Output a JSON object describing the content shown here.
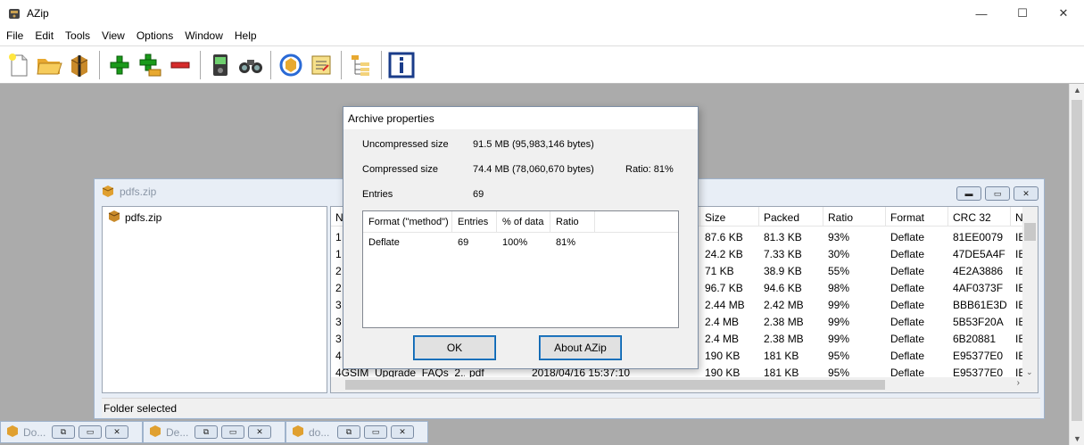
{
  "app": {
    "title": "AZip"
  },
  "window_controls": {
    "minimize": "—",
    "maximize": "☐",
    "close": "✕"
  },
  "menu": [
    "File",
    "Edit",
    "Tools",
    "View",
    "Options",
    "Window",
    "Help"
  ],
  "toolbar": {
    "icons": [
      "new-archive-icon",
      "open-archive-icon",
      "extract-icon",
      "add-icon",
      "add-folder-icon",
      "delete-icon",
      "test-icon",
      "find-icon",
      "recompress-icon",
      "update-icon",
      "tree-view-icon",
      "properties-icon"
    ]
  },
  "child_window": {
    "title": "pdfs.zip",
    "tree": {
      "item": "pdfs.zip"
    },
    "list": {
      "columns": [
        "N",
        "Size",
        "Packed",
        "Ratio",
        "Format",
        "CRC 32",
        "N"
      ],
      "rows": [
        {
          "n": "1",
          "size": "87.6 KB",
          "packed": "81.3 KB",
          "ratio": "93%",
          "format": "Deflate",
          "crc": "81EE0079",
          "x": "IE"
        },
        {
          "n": "1",
          "size": "24.2 KB",
          "packed": "7.33 KB",
          "ratio": "30%",
          "format": "Deflate",
          "crc": "47DE5A4F",
          "x": "IE"
        },
        {
          "n": "2",
          "size": "71 KB",
          "packed": "38.9 KB",
          "ratio": "55%",
          "format": "Deflate",
          "crc": "4E2A3886",
          "x": "IE"
        },
        {
          "n": "2",
          "size": "96.7 KB",
          "packed": "94.6 KB",
          "ratio": "98%",
          "format": "Deflate",
          "crc": "4AF0373F",
          "x": "IE"
        },
        {
          "n": "3",
          "size": "2.44 MB",
          "packed": "2.42 MB",
          "ratio": "99%",
          "format": "Deflate",
          "crc": "BBB61E3D",
          "x": "IE"
        },
        {
          "n": "3",
          "size": "2.4 MB",
          "packed": "2.38 MB",
          "ratio": "99%",
          "format": "Deflate",
          "crc": "5B53F20A",
          "x": "IE"
        },
        {
          "n": "3",
          "size": "2.4 MB",
          "packed": "2.38 MB",
          "ratio": "99%",
          "format": "Deflate",
          "crc": "6B20881",
          "x": "IE"
        },
        {
          "n": "4",
          "size": "190 KB",
          "packed": "181 KB",
          "ratio": "95%",
          "format": "Deflate",
          "crc": "E95377E0",
          "x": "IE"
        },
        {
          "n": "4GSIM_Upgrade_FAQs_2...",
          "type": "pdf",
          "date": "2018/04/16 15:37:10",
          "size": "190 KB",
          "packed": "181 KB",
          "ratio": "95%",
          "format": "Deflate",
          "crc": "E95377E0",
          "x": "IE"
        }
      ]
    },
    "status": "Folder selected"
  },
  "minimized_windows": [
    {
      "title": "Do..."
    },
    {
      "title": "De..."
    },
    {
      "title": "do..."
    }
  ],
  "dialog": {
    "title": "Archive properties",
    "uncompressed_label": "Uncompressed size",
    "uncompressed_value": "91.5 MB (95,983,146 bytes)",
    "compressed_label": "Compressed size",
    "compressed_value": "74.4 MB (78,060,670 bytes)",
    "ratio_text": "Ratio: 81%",
    "entries_label": "Entries",
    "entries_value": "69",
    "table": {
      "headers": [
        "Format (\"method\")",
        "Entries",
        "% of data",
        "Ratio"
      ],
      "rows": [
        {
          "format": "Deflate",
          "entries": "69",
          "pct": "100%",
          "ratio": "81%"
        }
      ]
    },
    "ok_label": "OK",
    "about_label": "About AZip"
  }
}
